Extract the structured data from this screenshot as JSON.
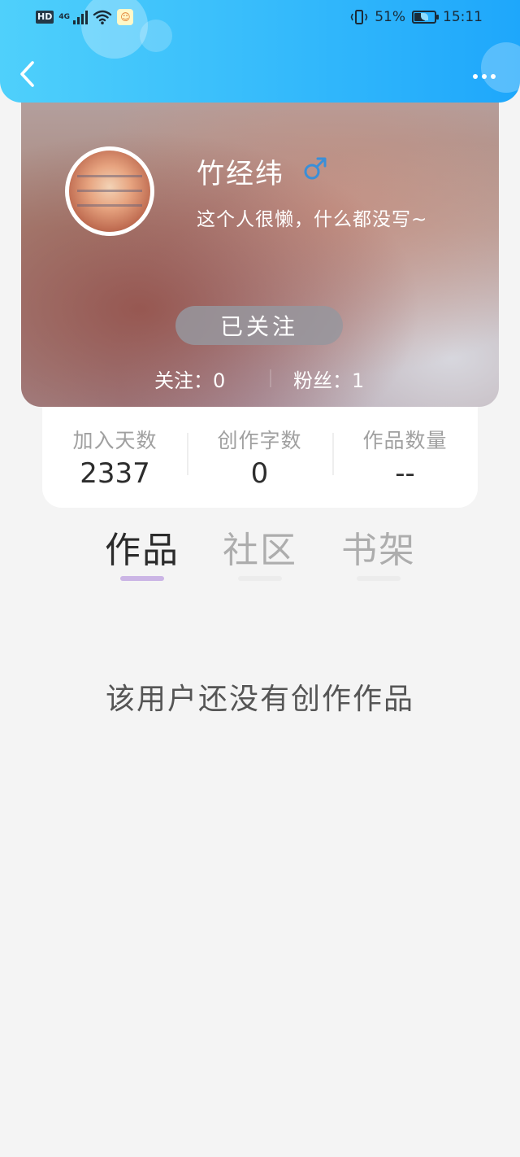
{
  "status_bar": {
    "hd": "HD",
    "network": "4G",
    "battery_percent": "51%",
    "battery_level": 0.51,
    "time": "15:11"
  },
  "header": {
    "back_icon": "chevron-left-icon",
    "more_icon": "more-dots-icon"
  },
  "profile": {
    "name": "竹经纬",
    "gender_symbol": "♂",
    "gender_color": "#3a8fd8",
    "bio": "这个人很懒，什么都没写~",
    "follow_button_label": "已关注",
    "following_text": "关注：0",
    "fans_text": "粉丝：1"
  },
  "stats": [
    {
      "label": "加入天数",
      "value": "2337"
    },
    {
      "label": "创作字数",
      "value": "0"
    },
    {
      "label": "作品数量",
      "value": "--"
    }
  ],
  "tabs": [
    {
      "label": "作品",
      "active": true
    },
    {
      "label": "社区",
      "active": false
    },
    {
      "label": "书架",
      "active": false
    }
  ],
  "empty_state": "该用户还没有创作作品",
  "colors": {
    "header_gradient_start": "#4fd0fb",
    "header_gradient_end": "#1ea7fb",
    "active_tab_underline": "#cbb5e5",
    "page_background": "#f4f4f4"
  }
}
